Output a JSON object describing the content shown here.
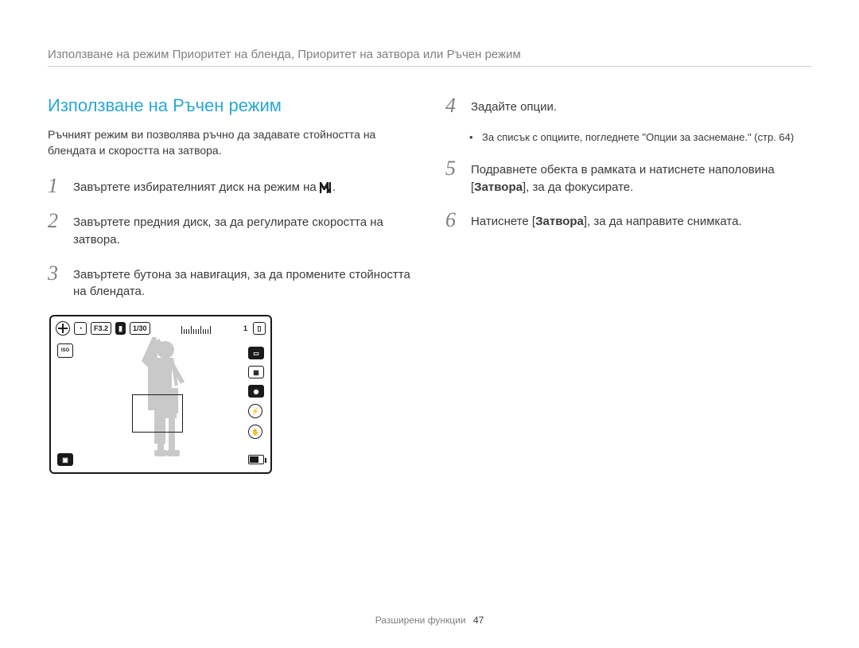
{
  "breadcrumb": "Използване на режим Приоритет на бленда, Приоритет на затвора или Ръчен режим",
  "left": {
    "title": "Използване на Ръчен режим",
    "intro": "Ръчният режим ви позволява ръчно да задавате стойността на блендата и скоростта на затвора.",
    "step1_pre": "Завъртете избирателният диск на режим на ",
    "step1_post": ".",
    "step2": "Завъртете предния диск, за да регулирате скоростта на затвора.",
    "step3": "Завъртете бутона за навигация, за да промените стойността на блендата."
  },
  "right": {
    "step4": "Задайте опции.",
    "bullet4": "За списък с опциите, погледнете \"Опции за заснемане.\" (стр. 64)",
    "step5_pre": "Подравнете обекта в рамката и натиснете наполовина [",
    "step5_b": "Затвора",
    "step5_post": "], за да фокусирате.",
    "step6_pre": "Натиснете [",
    "step6_b": "Затвора",
    "step6_post": "], за да направите снимката."
  },
  "screen": {
    "f": "F3.2",
    "shutter": "1/30",
    "count": "1",
    "iso": "ISO"
  },
  "footer": {
    "label": "Разширени функции",
    "page": "47"
  }
}
